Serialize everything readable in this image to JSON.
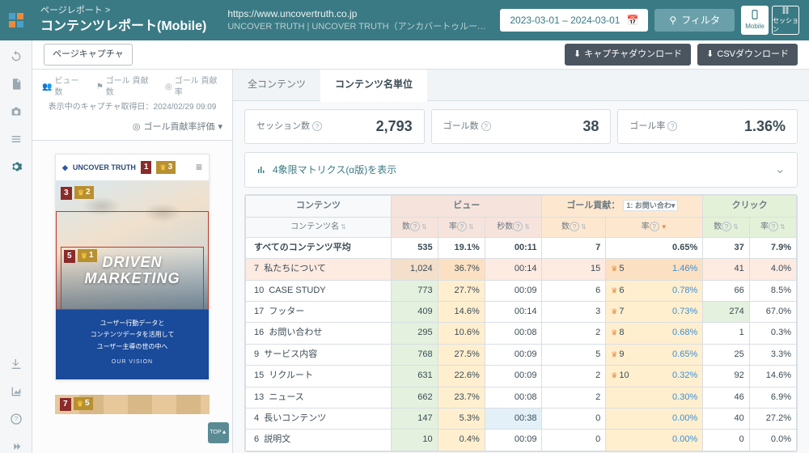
{
  "header": {
    "breadcrumb": "ページレポート  >",
    "title": "コンテンツレポート(Mobile)",
    "url": "https://www.uncovertruth.co.jp",
    "url_desc": "UNCOVER TRUTH | UNCOVER TRUTH（アンカバートゥルース）は、ユーザー体験…",
    "date_range": "2023-03-01 – 2024-03-01",
    "filter": "フィルタ",
    "devices": [
      {
        "label": "Mobile"
      },
      {
        "label": "セッション"
      }
    ]
  },
  "toolbar": {
    "capture": "ページキャプチャ",
    "dl_capture": "キャプチャダウンロード",
    "dl_csv": "CSVダウンロード"
  },
  "left": {
    "metrics": [
      {
        "label": "ビュー数"
      },
      {
        "label": "ゴール\n貢献数"
      },
      {
        "label": "ゴール\n貢献率"
      }
    ],
    "capture_date": "表示中のキャプチャ取得日：2024/02/29 09:09",
    "goal_eval": "ゴール貢献率評価",
    "preview": {
      "brand": "UNCOVER TRUTH",
      "hero_line1": "DRIVEN",
      "hero_line2": "MARKETING",
      "desc1": "ユーザー行動データと",
      "desc2": "コンテンツデータを活用して",
      "desc3": "ユーザー主導の世の中へ",
      "vision": "OUR VISION",
      "badges": {
        "b1": "1",
        "b3": "3",
        "b3l": "3",
        "b2": "2",
        "b5": "5",
        "b1y": "1",
        "b7": "7",
        "b5y": "5"
      },
      "top": "TOP▲"
    }
  },
  "right": {
    "tabs": [
      {
        "label": "全コンテンツ"
      },
      {
        "label": "コンテンツ名単位"
      }
    ],
    "active_tab": 1,
    "stats": [
      {
        "label": "セッション数",
        "value": "2,793"
      },
      {
        "label": "ゴール数",
        "value": "38"
      },
      {
        "label": "ゴール率",
        "value": "1.36%"
      }
    ],
    "matrix": "4象限マトリクス(α版)を表示",
    "table": {
      "groups": {
        "content": "コンテンツ",
        "view": "ビュー",
        "goal": "ゴール貢献：",
        "goal_sel": "1: お問い合わ",
        "click": "クリック"
      },
      "subs": {
        "name": "コンテンツ名",
        "cnt": "数",
        "rate": "率",
        "sec": "秒数"
      },
      "avg": {
        "name": "すべてのコンテンツ平均",
        "v_cnt": "535",
        "v_rate": "19.1%",
        "v_sec": "00:11",
        "g_cnt": "7",
        "g_rate": "0.65%",
        "c_cnt": "37",
        "c_rate": "7.9%"
      },
      "rows": [
        {
          "idx": "7",
          "name": "私たちについて",
          "v_cnt": "1,024",
          "v_rate": "36.7%",
          "v_sec": "00:14",
          "g_cnt": "15",
          "rank": "5",
          "g_rate": "1.46%",
          "c_cnt": "41",
          "c_rate": "4.0%",
          "hl": true
        },
        {
          "idx": "10",
          "name": "CASE STUDY",
          "v_cnt": "773",
          "v_rate": "27.7%",
          "v_sec": "00:09",
          "g_cnt": "6",
          "rank": "6",
          "g_rate": "0.78%",
          "c_cnt": "66",
          "c_rate": "8.5%"
        },
        {
          "idx": "17",
          "name": "フッター",
          "v_cnt": "409",
          "v_rate": "14.6%",
          "v_sec": "00:14",
          "g_cnt": "3",
          "rank": "7",
          "g_rate": "0.73%",
          "c_cnt": "274",
          "c_rate": "67.0%",
          "cg_click": true
        },
        {
          "idx": "16",
          "name": "お問い合わせ",
          "v_cnt": "295",
          "v_rate": "10.6%",
          "v_sec": "00:08",
          "g_cnt": "2",
          "rank": "8",
          "g_rate": "0.68%",
          "c_cnt": "1",
          "c_rate": "0.3%"
        },
        {
          "idx": "9",
          "name": "サービス内容",
          "v_cnt": "768",
          "v_rate": "27.5%",
          "v_sec": "00:09",
          "g_cnt": "5",
          "rank": "9",
          "g_rate": "0.65%",
          "c_cnt": "25",
          "c_rate": "3.3%"
        },
        {
          "idx": "15",
          "name": "リクルート",
          "v_cnt": "631",
          "v_rate": "22.6%",
          "v_sec": "00:09",
          "g_cnt": "2",
          "rank": "10",
          "g_rate": "0.32%",
          "c_cnt": "92",
          "c_rate": "14.6%"
        },
        {
          "idx": "13",
          "name": "ニュース",
          "v_cnt": "662",
          "v_rate": "23.7%",
          "v_sec": "00:08",
          "g_cnt": "2",
          "rank": "",
          "g_rate": "0.30%",
          "c_cnt": "46",
          "c_rate": "6.9%"
        },
        {
          "idx": "4",
          "name": "長いコンテンツ",
          "v_cnt": "147",
          "v_rate": "5.3%",
          "v_sec": "00:38",
          "g_cnt": "0",
          "rank": "",
          "g_rate": "0.00%",
          "c_cnt": "40",
          "c_rate": "27.2%",
          "cb_sec": true
        },
        {
          "idx": "6",
          "name": "説明文",
          "v_cnt": "10",
          "v_rate": "0.4%",
          "v_sec": "00:09",
          "g_cnt": "0",
          "rank": "",
          "g_rate": "0.00%",
          "c_cnt": "0",
          "c_rate": "0.0%"
        }
      ]
    }
  }
}
